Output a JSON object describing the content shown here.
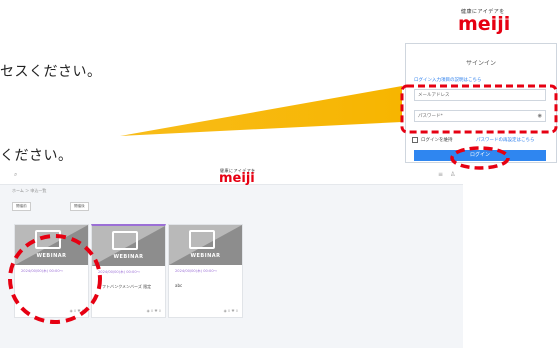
{
  "instructions": {
    "line1": "セスください。",
    "line2": "ください。"
  },
  "login": {
    "brand_tag": "健康にアイデアを",
    "brand_logo": "meiji",
    "title": "サインイン",
    "help_link": "ログイン入力項目の説明はこちら",
    "email_label": "メールアドレス",
    "password_label": "パスワード*",
    "remember_label": "ログインを維持",
    "forgot_link": "パスワードの再設定はこちら",
    "login_button": "ログイン"
  },
  "dashboard": {
    "brand_tag": "健康にアイデアを",
    "brand_logo": "meiji",
    "breadcrumb": "ホーム ＞ 申込一覧",
    "filter_tabs": [
      "開催前",
      "開催後"
    ],
    "tiles": [
      {
        "badge": "WEBINAR",
        "date": "2024/00/00(木) 00:00〜",
        "title": "",
        "foot": "◉ 0 ♥ 0"
      },
      {
        "badge": "WEBINAR",
        "date": "2024/00/00(木) 00:00〜",
        "title": "ソフトバンクメンバーズ 限定",
        "foot": "◉ 0 ♥ 0"
      },
      {
        "badge": "WEBINAR",
        "date": "2024/00/00(木) 00:00〜",
        "title": "abc",
        "foot": "◉ 0 ♥ 0"
      }
    ]
  },
  "colors": {
    "annotation_red": "#e60012",
    "beam_yellow": "#f7b500",
    "brand_red": "#e60012",
    "accent_blue": "#2f86f0"
  }
}
